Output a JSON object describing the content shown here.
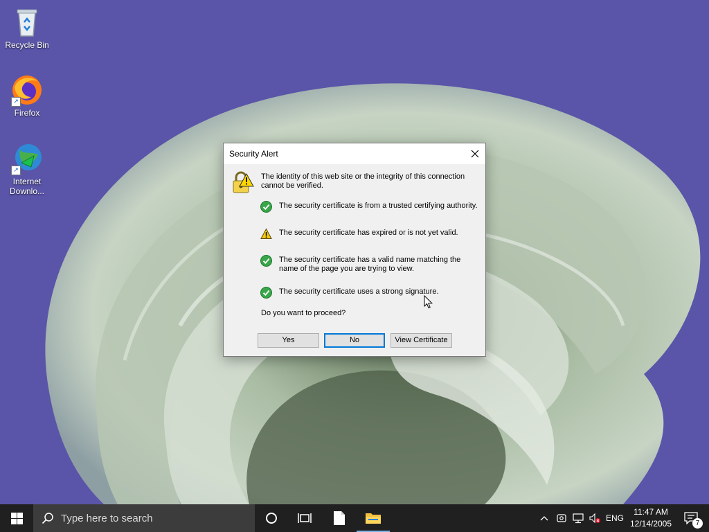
{
  "desktop": {
    "icons": [
      {
        "label": "Recycle Bin",
        "icon": "recycle-bin-icon"
      },
      {
        "label": "Firefox",
        "icon": "firefox-icon"
      },
      {
        "label": "Internet Downlo...",
        "icon": "internet-download-manager-icon"
      }
    ]
  },
  "dialog": {
    "title": "Security Alert",
    "intro": "The identity of this web site or the integrity of this connection cannot be verified.",
    "checks": [
      {
        "status": "ok",
        "text": "The security certificate is from a trusted certifying authority."
      },
      {
        "status": "warning",
        "text": "The security certificate has expired or is not yet valid."
      },
      {
        "status": "ok",
        "text": "The security certificate has a valid name matching the name of the page you are trying to view."
      },
      {
        "status": "ok",
        "text": "The security certificate uses a strong signature."
      }
    ],
    "question": "Do you want to proceed?",
    "buttons": {
      "yes": "Yes",
      "no": "No",
      "view_certificate": "View Certificate"
    },
    "default_button": "no"
  },
  "taskbar": {
    "search_placeholder": "Type here to search",
    "language": "ENG",
    "time": "11:47 AM",
    "date": "12/14/2005",
    "notification_count": "7"
  },
  "colors": {
    "wallpaper": "#5a55a8",
    "taskbar": "#202020",
    "accent": "#0078d7",
    "ok_green": "#3aa64a",
    "warning_yellow": "#f2c811"
  }
}
